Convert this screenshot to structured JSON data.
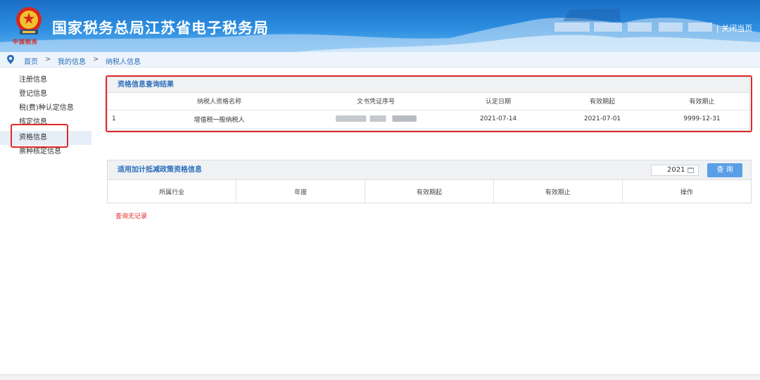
{
  "header": {
    "title": "国家税务总局江苏省电子税务局",
    "emblem_caption": "中国税务",
    "close_label": "| 关闭当页"
  },
  "breadcrumb": {
    "items": [
      "首页",
      "我的信息",
      "纳税人信息"
    ],
    "separator": ">"
  },
  "sidebar": {
    "items": [
      {
        "label": "注册信息"
      },
      {
        "label": "登记信息"
      },
      {
        "label": "税(费)种认定信息"
      },
      {
        "label": "核定信息"
      },
      {
        "label": "资格信息",
        "active": true
      },
      {
        "label": "票种核定信息"
      }
    ]
  },
  "qualification": {
    "title": "资格信息查询结果",
    "columns": [
      "",
      "纳税人资格名称",
      "文书凭证序号",
      "认定日期",
      "有效期起",
      "有效期止"
    ],
    "rows": [
      {
        "index": "1",
        "name": "增值税一般纳税人",
        "doc_no": "",
        "date": "2021-07-14",
        "start": "2021-07-01",
        "end": "9999-12-31"
      }
    ]
  },
  "deduction": {
    "title": "适用加计抵减政策资格信息",
    "year": "2021",
    "query_label": "查 询",
    "columns": [
      "所属行业",
      "年度",
      "有效期起",
      "有效期止",
      "操作"
    ],
    "empty_text": "查询无记录"
  },
  "colors": {
    "header_blue": "#2c8ee0",
    "link_blue": "#2a6ebb",
    "highlight_red": "#e0292b",
    "button_blue": "#5a9fe6"
  }
}
